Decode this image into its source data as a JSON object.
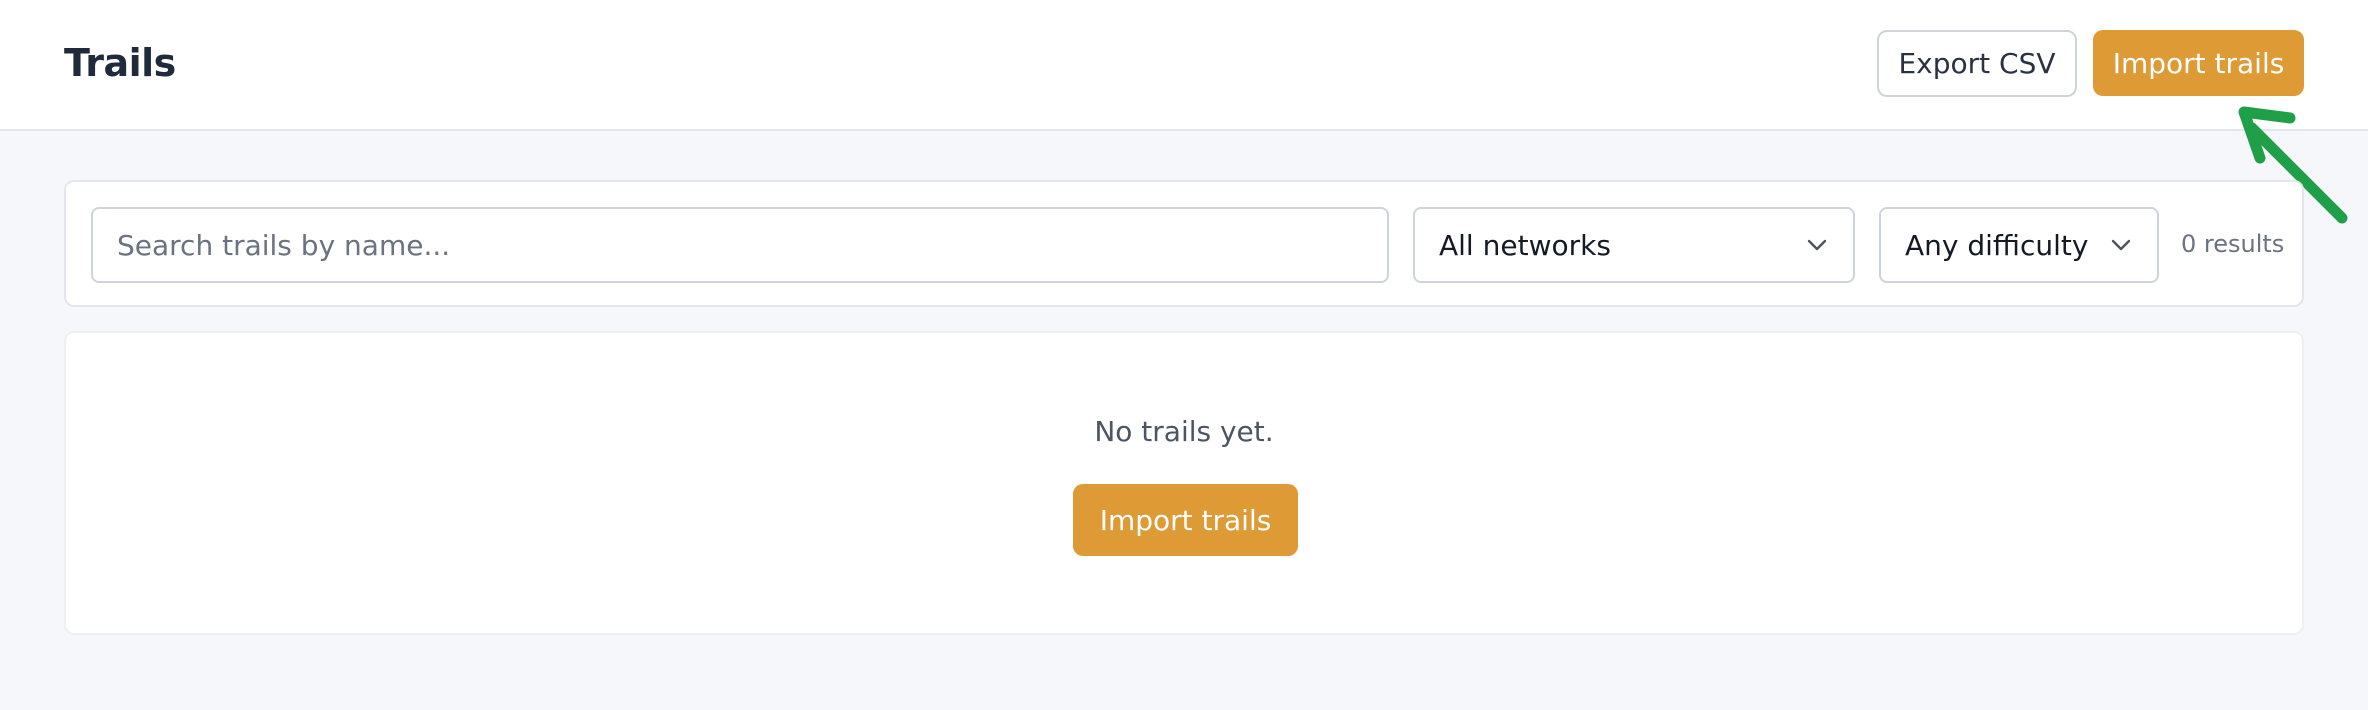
{
  "header": {
    "title": "Trails",
    "export_label": "Export CSV",
    "import_label": "Import trails"
  },
  "filters": {
    "search_placeholder": "Search trails by name...",
    "search_value": "",
    "network_selected": "All networks",
    "difficulty_selected": "Any difficulty",
    "results_text": "0 results"
  },
  "empty_state": {
    "message": "No trails yet.",
    "import_label": "Import trails"
  },
  "icons": {
    "select_chevron": "chevron-down-icon",
    "annotation": "arrow-pointer-icon"
  },
  "colors": {
    "accent": "#de9a34",
    "annotation": "#1fa048",
    "background": "#f6f7fb"
  }
}
